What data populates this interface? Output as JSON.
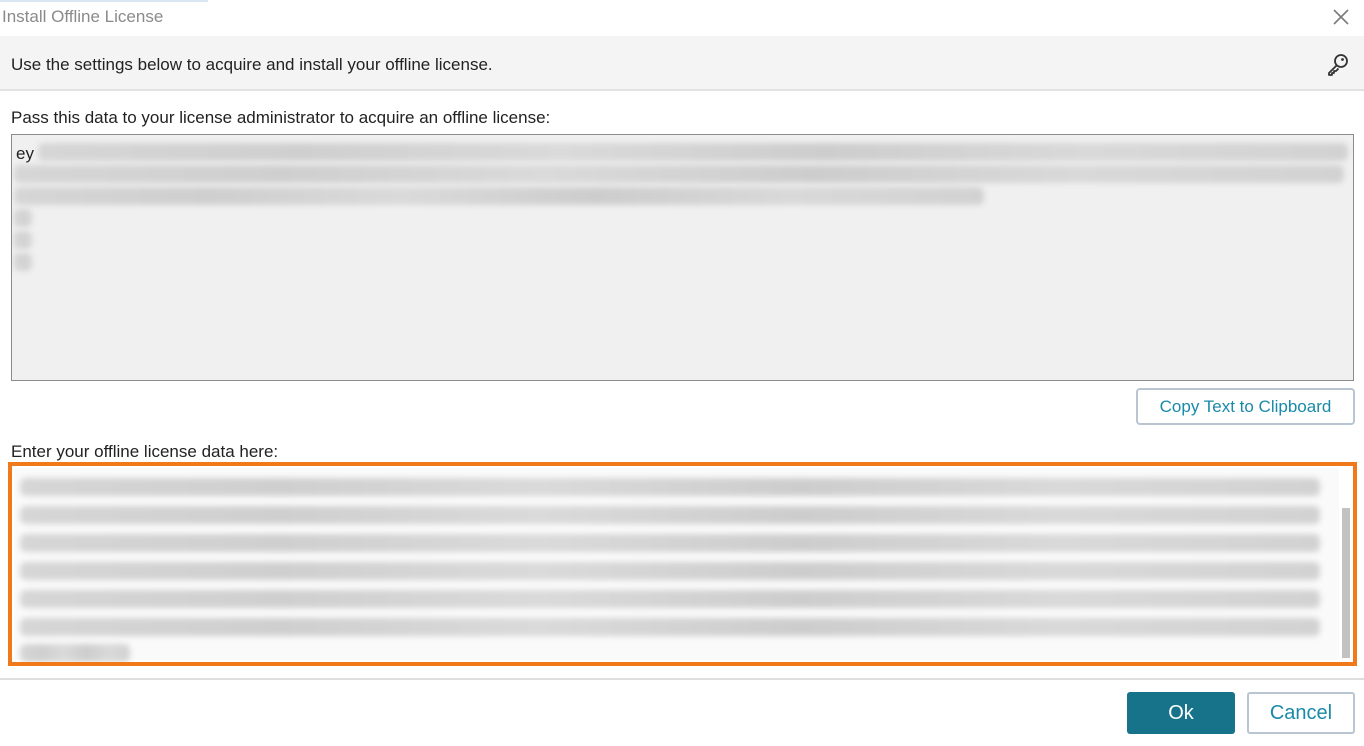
{
  "window": {
    "title": "Install Offline License"
  },
  "header": {
    "instruction": "Use the settings below to acquire and install your offline license."
  },
  "request_section": {
    "label": "Pass this data to your license administrator to acquire an offline license:",
    "visible_prefix": "ey"
  },
  "copy_button": {
    "label": "Copy Text to Clipboard"
  },
  "license_section": {
    "label": "Enter your offline license data here:"
  },
  "footer": {
    "ok_label": "Ok",
    "cancel_label": "Cancel"
  },
  "icons": {
    "close": "close-icon",
    "key": "key-icon"
  },
  "colors": {
    "primary": "#177389",
    "accent_text": "#1a8aa8",
    "highlight_border": "#f07a1a"
  }
}
